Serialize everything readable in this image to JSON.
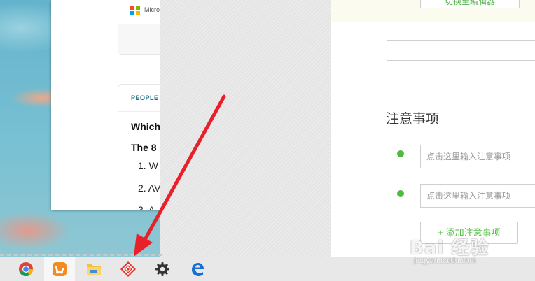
{
  "background_window": {
    "microsoft_label": "Micro",
    "people_header": "PEOPLE",
    "question_1": "Which",
    "question_2": "The 8",
    "list_items": [
      "1.  W",
      "2.  AV",
      "3.  A"
    ]
  },
  "form": {
    "top_button_label": "切换至编辑器",
    "section_title": "注意事项",
    "note_placeholder": "点击这里输入注意事项",
    "add_note_label": "+ 添加注意事项",
    "accent_color": "#4dbb3e"
  },
  "taskbar": {
    "apps": [
      "chrome-icon",
      "uc-browser-icon",
      "file-explorer-icon",
      "red-app-icon",
      "settings-icon",
      "edge-icon"
    ]
  },
  "annotation": {
    "arrow_color": "#e8202a"
  },
  "watermark": {
    "main": "Bai 经验",
    "sub": "jingyan.baidu.com"
  }
}
